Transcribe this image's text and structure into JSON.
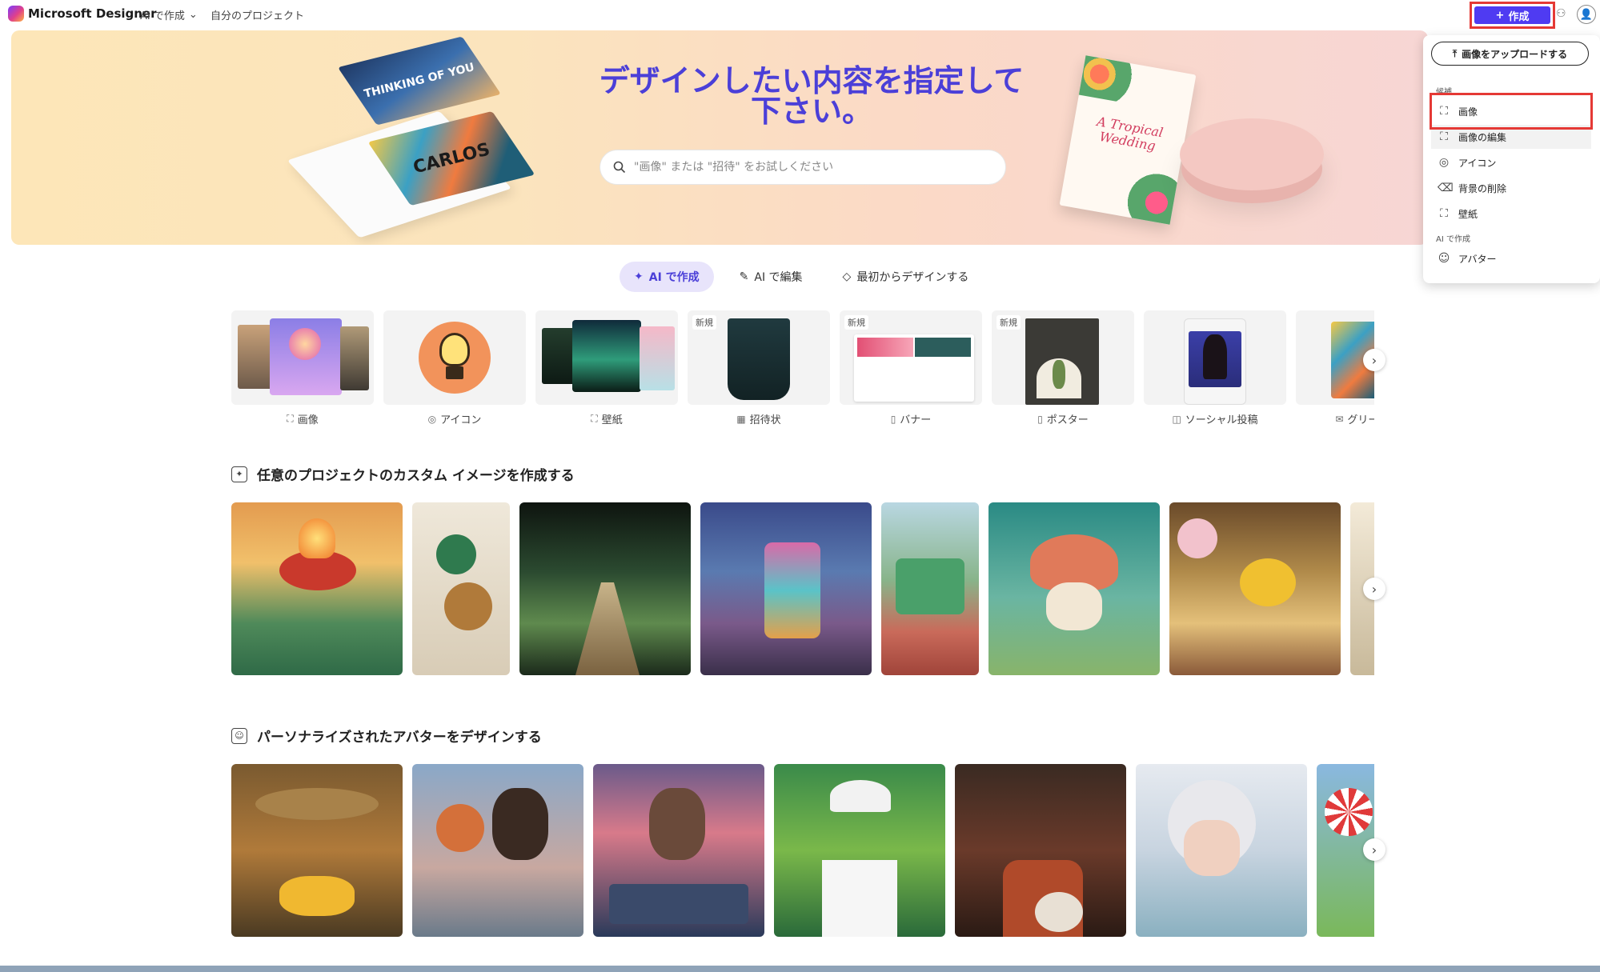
{
  "app": {
    "title": "Microsoft Designer",
    "nav_ai": "AI で作成",
    "nav_projects": "自分のプロジェクト",
    "create_label": "作成"
  },
  "hero": {
    "title": "デザインしたい内容を指定して下さい。",
    "search_placeholder": "\"画像\" または \"招待\" をお試しください",
    "card_thinking": "THINKING OF YOU",
    "card_carlos": "CARLOS",
    "card_wedding": "A Tropical Wedding"
  },
  "tabs": [
    {
      "label": "AI で作成",
      "active": true
    },
    {
      "label": "AI で編集",
      "active": false
    },
    {
      "label": "最初からデザインする",
      "active": false
    }
  ],
  "templates": [
    {
      "label": "画像",
      "new": false,
      "icon": "image-icon"
    },
    {
      "label": "アイコン",
      "new": false,
      "icon": "icon-icon"
    },
    {
      "label": "壁紙",
      "new": false,
      "icon": "wallpaper-icon"
    },
    {
      "label": "招待状",
      "new": true,
      "icon": "calendar-icon"
    },
    {
      "label": "バナー",
      "new": true,
      "icon": "banner-icon"
    },
    {
      "label": "ポスター",
      "new": true,
      "icon": "poster-icon"
    },
    {
      "label": "ソーシャル投稿",
      "new": false,
      "icon": "social-icon"
    },
    {
      "label": "グリーティ",
      "new": false,
      "icon": "mail-icon"
    }
  ],
  "new_badge": "新規",
  "sections": {
    "custom_images_title": "任意のプロジェクトのカスタム イメージを作成する",
    "avatars_title": "パーソナライズされたアバターをデザインする"
  },
  "dropdown": {
    "upload_label": "画像をアップロードする",
    "section1": "候補",
    "items1": [
      {
        "label": "画像",
        "icon": "image-icon"
      },
      {
        "label": "画像の編集",
        "icon": "image-edit-icon"
      },
      {
        "label": "アイコン",
        "icon": "icon-icon"
      },
      {
        "label": "背景の削除",
        "icon": "eraser-icon"
      },
      {
        "label": "壁紙",
        "icon": "wallpaper-icon"
      }
    ],
    "section2": "AI で作成",
    "items2": [
      {
        "label": "アバター",
        "icon": "avatar-icon"
      }
    ]
  },
  "colors": {
    "accent": "#4f3bf2",
    "hero_title": "#4b3fd8",
    "highlight_red": "#e53935"
  }
}
